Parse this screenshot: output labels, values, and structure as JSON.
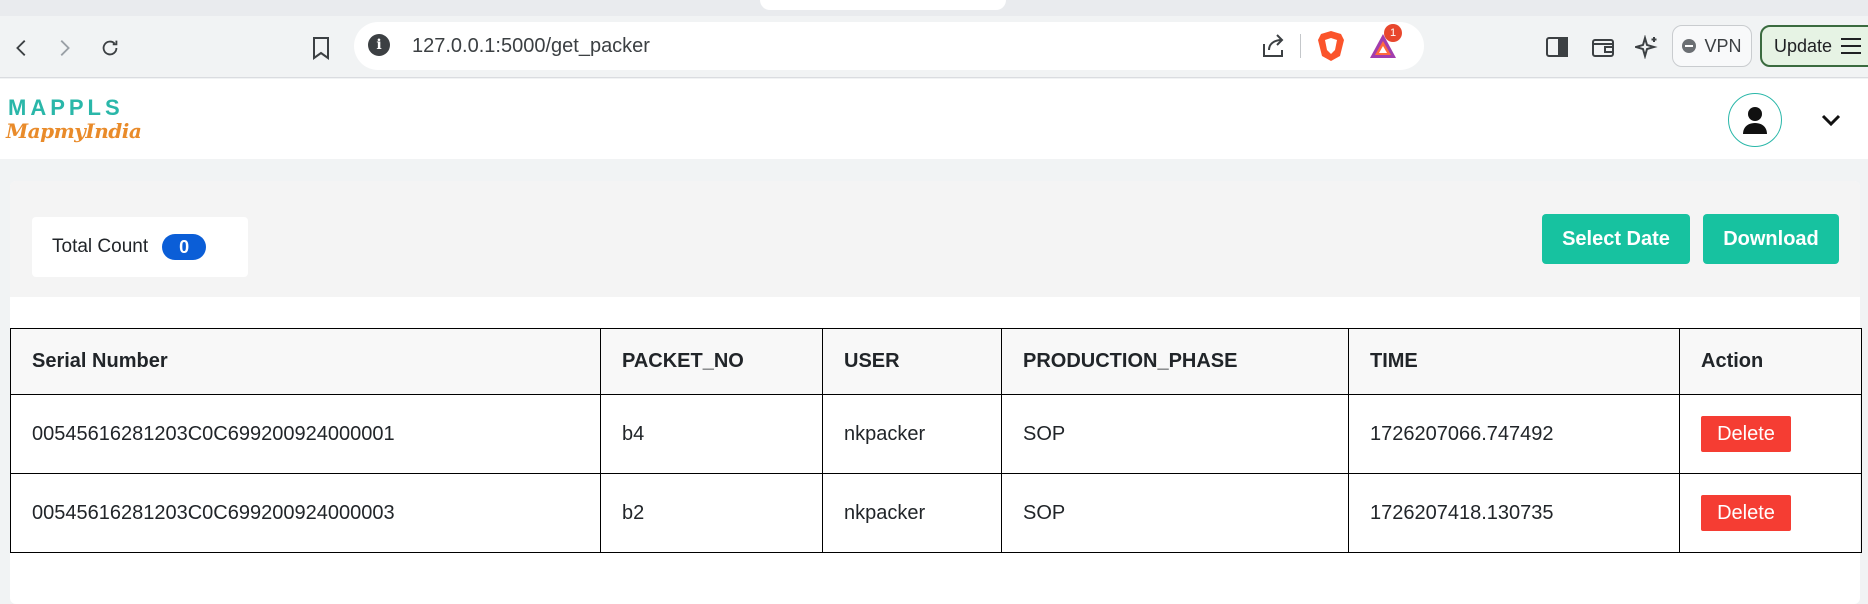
{
  "browser": {
    "url": "127.0.0.1:5000/get_packer",
    "rewards_badge": "1",
    "vpn_label": "VPN",
    "update_label": "Update"
  },
  "header": {
    "logo_top": "MAPPLS",
    "logo_bottom": "MapmyIndia"
  },
  "summary": {
    "total_count_label": "Total Count",
    "total_count_value": "0",
    "select_date_label": "Select Date",
    "download_label": "Download"
  },
  "table": {
    "headers": [
      "Serial Number",
      "PACKET_NO",
      "USER",
      "PRODUCTION_PHASE",
      "TIME",
      "Action"
    ],
    "rows": [
      {
        "serial": "00545616281203C0C699200924000001",
        "packet_no": "b4",
        "user": "nkpacker",
        "phase": "SOP",
        "time": "1726207066.747492",
        "action": "Delete"
      },
      {
        "serial": "00545616281203C0C699200924000003",
        "packet_no": "b2",
        "user": "nkpacker",
        "phase": "SOP",
        "time": "1726207418.130735",
        "action": "Delete"
      }
    ]
  },
  "colors": {
    "accent_teal": "#17c2a0",
    "count_badge": "#0b5ed7",
    "delete_red": "#f53d33",
    "logo_teal": "#2ab7a9",
    "logo_orange": "#e98b2a"
  }
}
